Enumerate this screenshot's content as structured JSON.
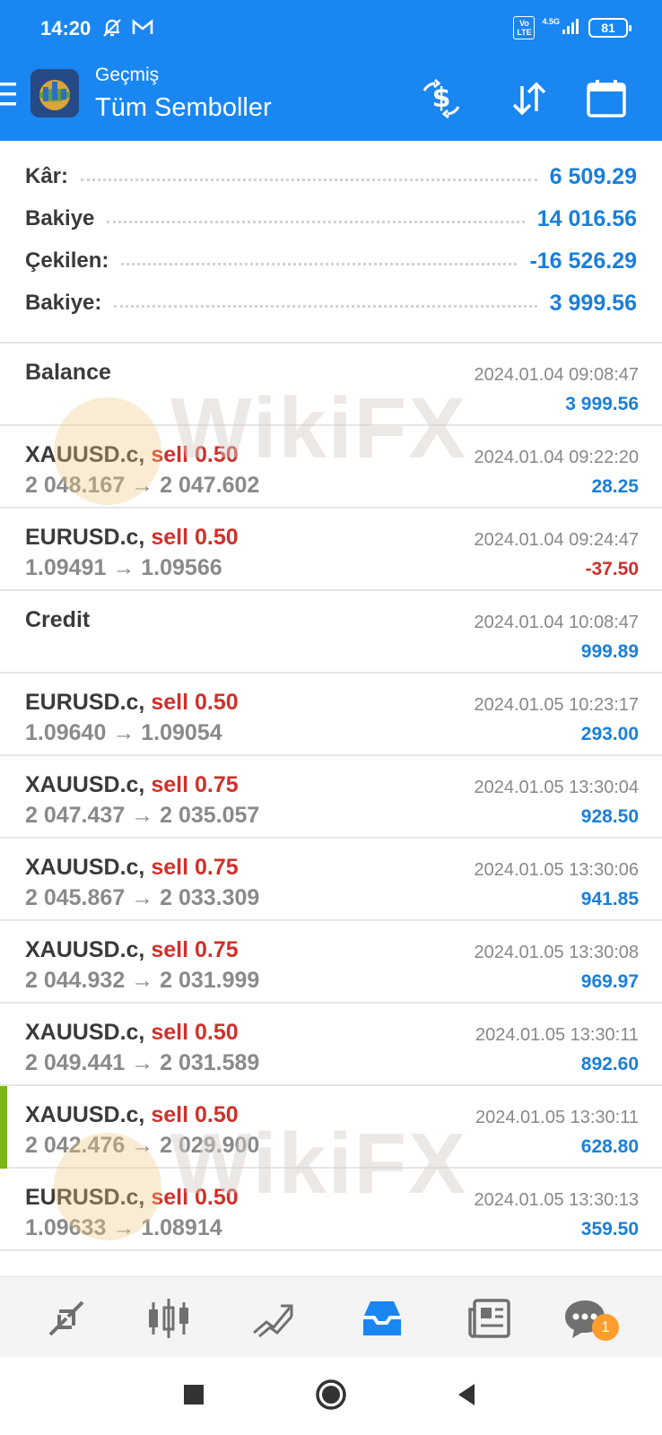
{
  "status_bar": {
    "time": "14:20",
    "network": "4.5G",
    "volte": "Vo LTE",
    "battery": "81"
  },
  "app_bar": {
    "subtitle": "Geçmiş",
    "title": "Tüm Semboller",
    "icons": [
      "menu-icon",
      "dollar-swap-icon",
      "sort-icon",
      "calendar-icon"
    ]
  },
  "summary": [
    {
      "label": "Kâr:",
      "value": "6 509.29"
    },
    {
      "label": "Bakiye",
      "value": "14 016.56"
    },
    {
      "label": "Çekilen:",
      "value": "-16 526.29"
    },
    {
      "label": "Bakiye:",
      "value": "3 999.56"
    }
  ],
  "deals": [
    {
      "symbol": "Balance",
      "side": "",
      "prices": "",
      "time": "2024.01.04 09:08:47",
      "profit": "3 999.56",
      "negative": false
    },
    {
      "symbol": "XAUUSD.c,",
      "side": "sell 0.50",
      "prices": "2 048.167 → 2 047.602",
      "time": "2024.01.04 09:22:20",
      "profit": "28.25",
      "negative": false
    },
    {
      "symbol": "EURUSD.c,",
      "side": "sell 0.50",
      "prices": "1.09491 → 1.09566",
      "time": "2024.01.04 09:24:47",
      "profit": "-37.50",
      "negative": true
    },
    {
      "symbol": "Credit",
      "side": "",
      "prices": "",
      "time": "2024.01.04 10:08:47",
      "profit": "999.89",
      "negative": false
    },
    {
      "symbol": "EURUSD.c,",
      "side": "sell 0.50",
      "prices": "1.09640 → 1.09054",
      "time": "2024.01.05 10:23:17",
      "profit": "293.00",
      "negative": false
    },
    {
      "symbol": "XAUUSD.c,",
      "side": "sell 0.75",
      "prices": "2 047.437 → 2 035.057",
      "time": "2024.01.05 13:30:04",
      "profit": "928.50",
      "negative": false
    },
    {
      "symbol": "XAUUSD.c,",
      "side": "sell 0.75",
      "prices": "2 045.867 → 2 033.309",
      "time": "2024.01.05 13:30:06",
      "profit": "941.85",
      "negative": false
    },
    {
      "symbol": "XAUUSD.c,",
      "side": "sell 0.75",
      "prices": "2 044.932 → 2 031.999",
      "time": "2024.01.05 13:30:08",
      "profit": "969.97",
      "negative": false
    },
    {
      "symbol": "XAUUSD.c,",
      "side": "sell 0.50",
      "prices": "2 049.441 → 2 031.589",
      "time": "2024.01.05 13:30:11",
      "profit": "892.60",
      "negative": false
    },
    {
      "symbol": "XAUUSD.c,",
      "side": "sell 0.50",
      "prices": "2 042.476 → 2 029.900",
      "time": "2024.01.05 13:30:11",
      "profit": "628.80",
      "negative": false
    },
    {
      "symbol": "EURUSD.c,",
      "side": "sell 0.50",
      "prices": "1.09633 → 1.08914",
      "time": "2024.01.05 13:30:13",
      "profit": "359.50",
      "negative": false
    }
  ],
  "watermark": "WikiFX",
  "bottom_nav": {
    "items": [
      "quotes-icon",
      "chart-icon",
      "trade-icon",
      "history-icon",
      "news-icon",
      "messages-icon"
    ],
    "active": "history-icon",
    "messages_badge": "1"
  },
  "colors": {
    "primary": "#1a86f2",
    "positive": "#1a7fd9",
    "negative": "#d0302a",
    "selected_marker": "#7cb518",
    "badge": "#ff9d2e"
  }
}
